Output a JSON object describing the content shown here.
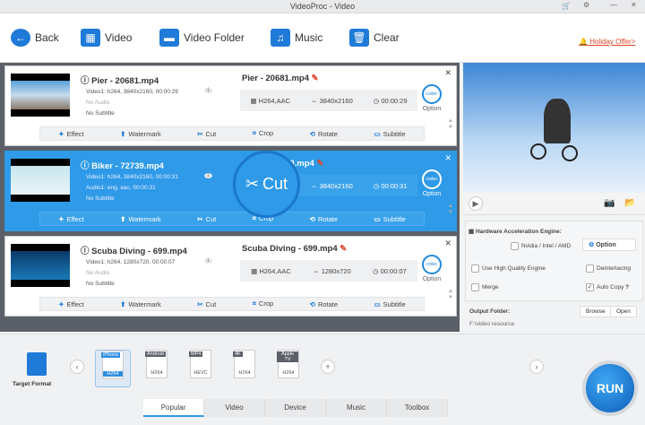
{
  "window": {
    "title": "VideoProc - Video"
  },
  "toolbar": {
    "back": "Back",
    "video": "Video",
    "video_folder": "Video Folder",
    "music": "Music",
    "clear": "Clear",
    "offer": "Holiday Offer>"
  },
  "edit_tools": [
    "Effect",
    "Watermark",
    "Cut",
    "Crop",
    "Rotate",
    "Subtitle"
  ],
  "items": [
    {
      "name": "Pier - 20681.mp4",
      "video": "Video1: h264, 3840x2160, 00:00:29",
      "audio": "No Audio",
      "subtitle": "No Subtitle",
      "out_name": "Pier - 20681.mp4",
      "codec": "H264,AAC",
      "resolution": "3840x2160",
      "duration": "00:00:29",
      "track_count": "1",
      "option": "Option"
    },
    {
      "name": "Biker - 72739.mp4",
      "video": "Video1: h264, 3840x2160, 00:00:31",
      "audio": "Audio1: eng, aac, 00:00:31",
      "subtitle": "No Subtitle",
      "out_name": "Biker - 72739.mp4",
      "out_name_visible": "mp4",
      "codec": "H264,AAC",
      "resolution": "3840x2160",
      "duration": "00:00:31",
      "track_count": "1",
      "option": "Option"
    },
    {
      "name": "Scuba Diving - 699.mp4",
      "video": "Video1: h264, 1280x720, 00:00:07",
      "audio": "No Audio",
      "subtitle": "No Subtitle",
      "out_name": "Scuba Diving - 699.mp4",
      "codec": "H264,AAC",
      "resolution": "1280x720",
      "duration": "00:00:07",
      "track_count": "1",
      "option": "Option"
    }
  ],
  "magnifier": {
    "label": "Cut"
  },
  "settings": {
    "hw_title": "Hardware Acceleration Engine:",
    "hw_option": "Nvidia / Intel / AMD",
    "option_button": "Option",
    "high_quality": "Use High Quality Engine",
    "deinterlacing": "Deinterlacing",
    "merge": "Merge",
    "auto_copy": "Auto Copy",
    "help": "?",
    "output_folder_label": "Output Folder:",
    "output_folder": "F:\\video resource",
    "browse": "Browse",
    "open": "Open"
  },
  "bottom": {
    "target_format": "Target Format",
    "formats": [
      {
        "label": "iPhone",
        "codec": "H264"
      },
      {
        "label": "Android",
        "codec": "H264"
      },
      {
        "label": "MP4",
        "codec": "HEVC"
      },
      {
        "label": "4K",
        "codec": "H264"
      },
      {
        "label": "Apple TV",
        "codec": "H264"
      }
    ],
    "tabs": [
      "Popular",
      "Video",
      "Device",
      "Music",
      "Toolbox"
    ],
    "run": "RUN"
  },
  "colors": {
    "accent": "#2e9ae8",
    "offer": "#e0462b"
  }
}
